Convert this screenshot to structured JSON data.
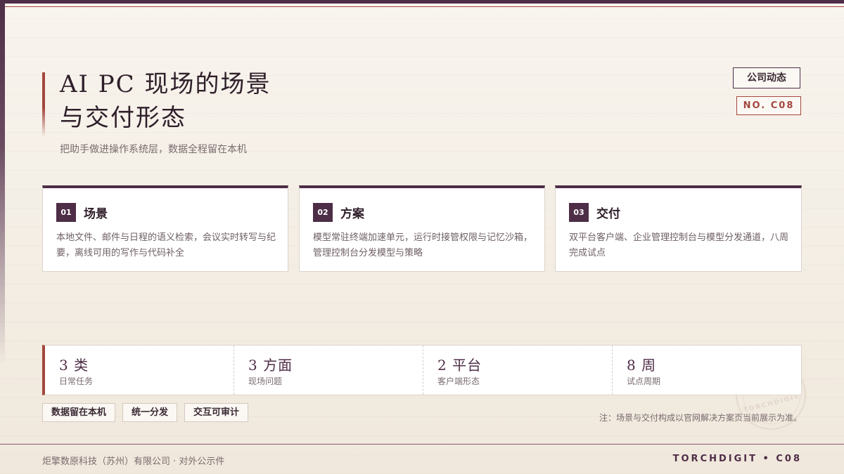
{
  "header": {
    "title_line1": "AI PC 现场的场景",
    "title_line2": "与交付形态",
    "subtitle": "把助手做进操作系统层，数据全程留在本机",
    "tag_dept": "公司动态",
    "tag_no": "NO. C08"
  },
  "cards": [
    {
      "num": "01",
      "title": "场景",
      "body": "本地文件、邮件与日程的语义检索，会议实时转写与纪要，离线可用的写作与代码补全"
    },
    {
      "num": "02",
      "title": "方案",
      "body": "模型常驻终端加速单元，运行时接管权限与记忆沙箱，管理控制台分发模型与策略"
    },
    {
      "num": "03",
      "title": "交付",
      "body": "双平台客户端、企业管理控制台与模型分发通道，八周完成试点"
    }
  ],
  "stats": [
    {
      "value": "3 类",
      "label": "日常任务"
    },
    {
      "value": "3 方面",
      "label": "现场问题"
    },
    {
      "value": "2 平台",
      "label": "客户端形态"
    },
    {
      "value": "8 周",
      "label": "试点周期"
    }
  ],
  "chips": [
    "数据留在本机",
    "统一分发",
    "交互可审计"
  ],
  "note": "注：场景与交付构成以官网解决方案页当前展示为准。",
  "stamp_text": "TORCHDIGIT",
  "footer": {
    "left": "炬擎数原科技（苏州）有限公司 · 对外公示件",
    "right": "TORCHDIGIT • C08"
  },
  "colors": {
    "primary": "#4e2d47",
    "accent": "#a3473e",
    "background": "#f6f1ea"
  }
}
